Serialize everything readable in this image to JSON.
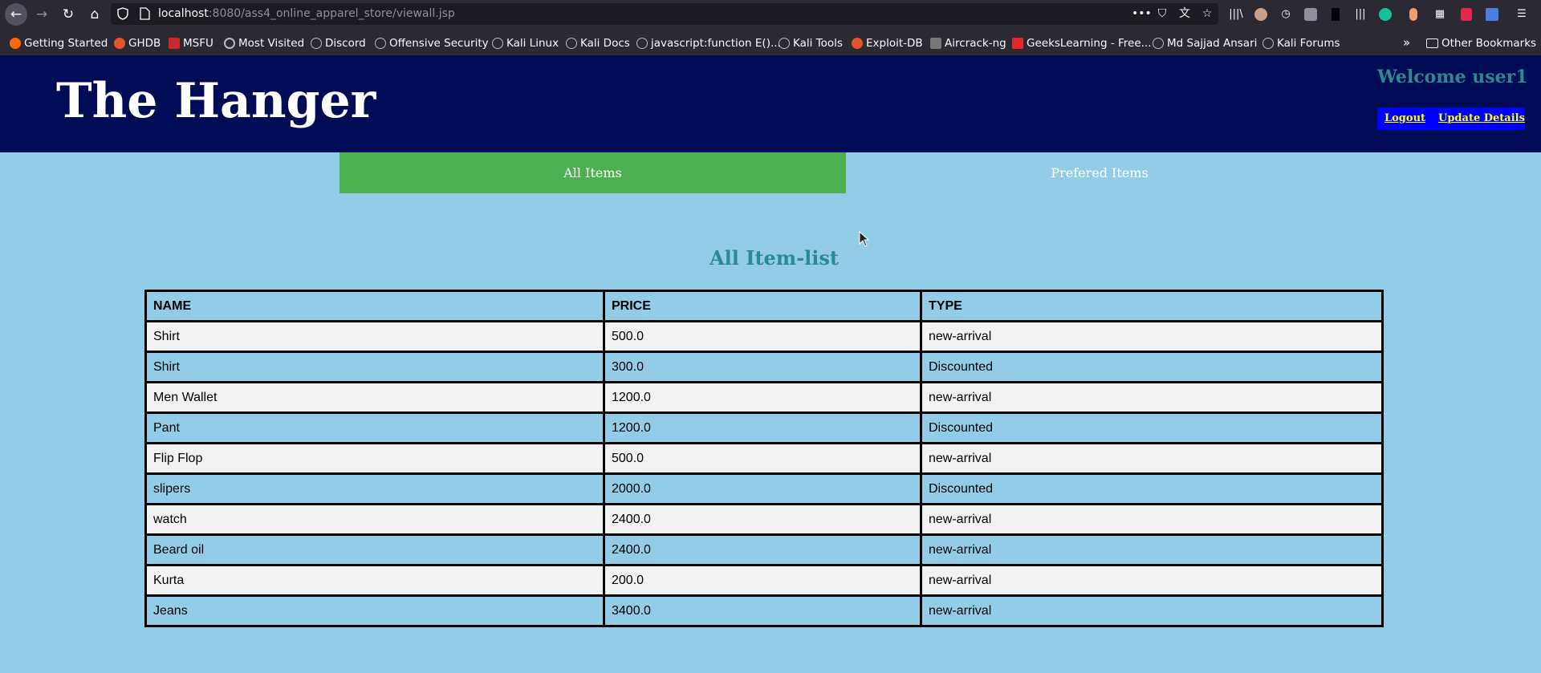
{
  "browser": {
    "url_host": "localhost",
    "url_path": ":8080/ass4_online_apparel_store/viewall.jsp",
    "bookmarks": [
      {
        "label": "Getting Started",
        "color": "#ff6611"
      },
      {
        "label": "GHDB",
        "color": "#e2562c"
      },
      {
        "label": "MSFU",
        "color": "#c42b2b"
      },
      {
        "label": "Most Visited",
        "color": "#bbbbbb"
      },
      {
        "label": "Discord",
        "color": "#bbbbbb"
      },
      {
        "label": "Offensive Security",
        "color": "#bbbbbb"
      },
      {
        "label": "Kali Linux",
        "color": "#bbbbbb"
      },
      {
        "label": "Kali Docs",
        "color": "#bbbbbb"
      },
      {
        "label": "javascript:function E()...",
        "color": "#bbbbbb"
      },
      {
        "label": "Kali Tools",
        "color": "#bbbbbb"
      },
      {
        "label": "Exploit-DB",
        "color": "#e2562c"
      },
      {
        "label": "Aircrack-ng",
        "color": "#777777"
      },
      {
        "label": "GeeksLearning - Free...",
        "color": "#e0282e"
      },
      {
        "label": "Md Sajjad Ansari",
        "color": "#bbbbbb"
      },
      {
        "label": "Kali Forums",
        "color": "#bbbbbb"
      }
    ],
    "other_bookmarks": "Other Bookmarks"
  },
  "header": {
    "title": "The Hanger",
    "welcome": "Welcome user1",
    "logout": "Logout",
    "update_details": "Update Details"
  },
  "tabs": {
    "all": "All Items",
    "preferred": "Prefered Items",
    "active_color": "#4caf50"
  },
  "list": {
    "title": "All Item-list",
    "columns": [
      "NAME",
      "PRICE",
      "TYPE"
    ],
    "rows": [
      [
        "Shirt",
        "500.0",
        "new-arrival"
      ],
      [
        "Shirt",
        "300.0",
        "Discounted"
      ],
      [
        "Men Wallet",
        "1200.0",
        "new-arrival"
      ],
      [
        "Pant",
        "1200.0",
        "Discounted"
      ],
      [
        "Flip Flop",
        "500.0",
        "new-arrival"
      ],
      [
        "slipers",
        "2000.0",
        "Discounted"
      ],
      [
        "watch",
        "2400.0",
        "new-arrival"
      ],
      [
        "Beard oil",
        "2400.0",
        "new-arrival"
      ],
      [
        "Kurta",
        "200.0",
        "new-arrival"
      ],
      [
        "Jeans",
        "3400.0",
        "new-arrival"
      ]
    ]
  }
}
